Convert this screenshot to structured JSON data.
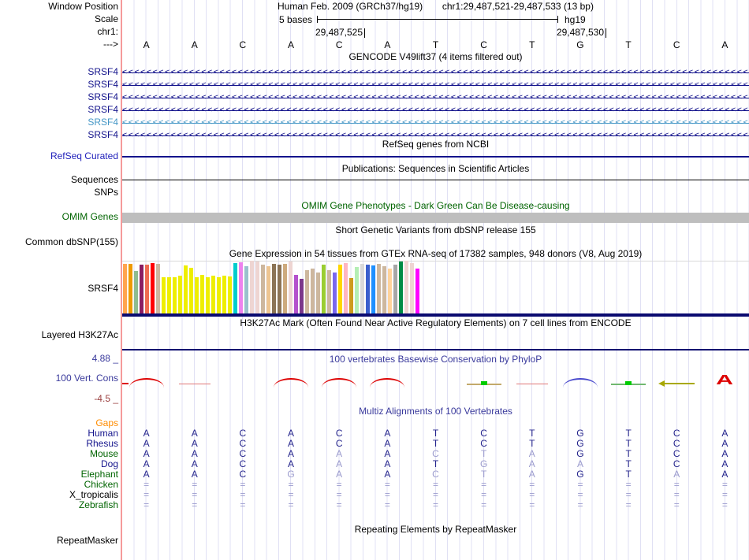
{
  "ruler": {
    "assembly": "Human Feb. 2009 (GRCh37/hg19)",
    "position": "chr1:29,487,521-29,487,533 (13 bp)",
    "scale_value": "5 bases",
    "genome": "hg19",
    "coord_left": "29,487,525",
    "coord_right": "29,487,530",
    "labels": {
      "window_position": "Window Position",
      "scale": "Scale",
      "chromosome": "chr1:",
      "strand": "--->"
    }
  },
  "sequence": {
    "bases": [
      "A",
      "A",
      "C",
      "A",
      "C",
      "A",
      "T",
      "C",
      "T",
      "G",
      "T",
      "C",
      "A"
    ]
  },
  "gencode": {
    "title": "GENCODE V49lift37 (4 items filtered out)",
    "transcripts": [
      {
        "label": "SRSF4",
        "color": "#14148C"
      },
      {
        "label": "SRSF4",
        "color": "#14148C"
      },
      {
        "label": "SRSF4",
        "color": "#14148C"
      },
      {
        "label": "SRSF4",
        "color": "#14148C"
      },
      {
        "label": "SRSF4",
        "color": "#4597C6"
      },
      {
        "label": "SRSF4",
        "color": "#14148C"
      }
    ]
  },
  "refseq": {
    "title": "RefSeq genes from NCBI",
    "label": "RefSeq Curated",
    "label_color": "#2222BB",
    "line_color": "#14148C"
  },
  "publications": {
    "title": "Publications: Sequences in Scientific Articles",
    "label": "Sequences"
  },
  "snps": {
    "label": "SNPs"
  },
  "omim": {
    "title": "OMIM Gene Phenotypes - Dark Green Can Be Disease-causing",
    "label": "OMIM Genes",
    "bar_color": "#BEBEBE"
  },
  "dbsnp": {
    "title": "Short Genetic Variants from dbSNP release 155",
    "label": "Common dbSNP(155)"
  },
  "gtex": {
    "title": "Gene Expression in 54 tissues from GTEx RNA-seq of 17382 samples, 948 donors (V8, Aug 2019)",
    "gene_label": "SRSF4",
    "baseline_color": "#0B0B70"
  },
  "chart_data": {
    "type": "bar",
    "title": "Gene Expression in 54 tissues from GTEx RNA-seq of 17382 samples, 948 donors (V8, Aug 2019)",
    "gene": "SRSF4",
    "ylim": [
      0,
      66
    ],
    "values": [
      63,
      63,
      54,
      62,
      62,
      64,
      63,
      46,
      46,
      46,
      48,
      61,
      58,
      46,
      49,
      46,
      48,
      46,
      48,
      47,
      64,
      65,
      60,
      67,
      66,
      62,
      60,
      63,
      62,
      63,
      66,
      49,
      44,
      55,
      57,
      52,
      62,
      55,
      52,
      62,
      64,
      45,
      59,
      63,
      62,
      61,
      63,
      60,
      57,
      62,
      66,
      67,
      64,
      57
    ],
    "colors": [
      "#FFA54F",
      "#EE9A00",
      "#8FBC8F",
      "#8B1C62",
      "#EE6A50",
      "#FF0000",
      "#CDB79E",
      "#EEEE00",
      "#EEEE00",
      "#EEEE00",
      "#EEEE00",
      "#EEEE00",
      "#EEEE00",
      "#EEEE00",
      "#EEEE00",
      "#EEEE00",
      "#EEEE00",
      "#EEEE00",
      "#EEEE00",
      "#EEEE00",
      "#00CDCD",
      "#EE82EE",
      "#9AC0CD",
      "#EED5D2",
      "#EED5D2",
      "#CDB79E",
      "#EEC591",
      "#8B7355",
      "#8B7355",
      "#CDAA7D",
      "#EED5D2",
      "#B452CD",
      "#7A378B",
      "#CDB79E",
      "#CDB79E",
      "#CDB79E",
      "#9ACD32",
      "#CDB79E",
      "#7A67EE",
      "#FFD700",
      "#FFB6C1",
      "#CD9B1D",
      "#B4EEB4",
      "#D9D9D9",
      "#3A5FCD",
      "#1E90FF",
      "#CDB79E",
      "#CDB79E",
      "#FFD39B",
      "#A6A6A6",
      "#008B45",
      "#EED5D2",
      "#EED5D2",
      "#FF00FF"
    ]
  },
  "h3k27ac": {
    "title": "H3K27Ac Mark (Often Found Near Active Regulatory Elements) on 7 cell lines from ENCODE",
    "label": "Layered H3K27Ac",
    "line_color": "#0B0B70"
  },
  "conservation": {
    "title": "100 vertebrates Basewise Conservation by PhyloP",
    "label": "100 Vert. Cons",
    "max_label": "4.88 _",
    "min_label": "-4.5 _",
    "max_color": "#3A3A9C",
    "min_color": "#9B4040",
    "glyphs": [
      {
        "col": 1,
        "type": "arc",
        "color": "#DD0000"
      },
      {
        "col": 2,
        "type": "line",
        "color": "#E07878"
      },
      {
        "col": 4,
        "type": "arc",
        "color": "#DD0000"
      },
      {
        "col": 5,
        "type": "arc",
        "color": "#DD0000"
      },
      {
        "col": 6,
        "type": "arc",
        "color": "#DD0000"
      },
      {
        "col": 8,
        "type": "block",
        "color": "#C3A96B",
        "accent": "#00CC00"
      },
      {
        "col": 9,
        "type": "line",
        "color": "#E07878"
      },
      {
        "col": 10,
        "type": "arc",
        "color": "#4747CC"
      },
      {
        "col": 11,
        "type": "block",
        "color": "#70B870",
        "accent": "#00CC00"
      },
      {
        "col": 12,
        "type": "arrow",
        "color": "#A8A800"
      },
      {
        "col": 13,
        "type": "letter",
        "value": "A",
        "color": "#DD0000"
      }
    ]
  },
  "multiz": {
    "title": "Multiz Alignments of 100 Vertebrates",
    "base_color": "#24248C",
    "dim_color": "#9C9CCE",
    "gaps_label_color": "#FF8C00",
    "rows": [
      {
        "name": "Gaps",
        "name_color": "#FF8C00",
        "bases": [],
        "dim": []
      },
      {
        "name": "Human",
        "name_color": "#14148C",
        "bases": [
          "A",
          "A",
          "C",
          "A",
          "C",
          "A",
          "T",
          "C",
          "T",
          "G",
          "T",
          "C",
          "A"
        ],
        "dim": [
          0,
          0,
          0,
          0,
          0,
          0,
          0,
          0,
          0,
          0,
          0,
          0,
          0
        ]
      },
      {
        "name": "Rhesus",
        "name_color": "#14148C",
        "bases": [
          "A",
          "A",
          "C",
          "A",
          "C",
          "A",
          "T",
          "C",
          "T",
          "G",
          "T",
          "C",
          "A"
        ],
        "dim": [
          0,
          0,
          0,
          0,
          0,
          0,
          0,
          0,
          0,
          0,
          0,
          0,
          0
        ]
      },
      {
        "name": "Mouse",
        "name_color": "#006400",
        "bases": [
          "A",
          "A",
          "C",
          "A",
          "A",
          "A",
          "C",
          "T",
          "A",
          "G",
          "T",
          "C",
          "A"
        ],
        "dim": [
          0,
          0,
          0,
          0,
          1,
          0,
          1,
          1,
          1,
          0,
          0,
          0,
          0
        ]
      },
      {
        "name": "Dog",
        "name_color": "#14148C",
        "bases": [
          "A",
          "A",
          "C",
          "A",
          "A",
          "A",
          "T",
          "G",
          "A",
          "A",
          "T",
          "C",
          "A"
        ],
        "dim": [
          0,
          0,
          0,
          0,
          1,
          0,
          0,
          1,
          1,
          1,
          0,
          0,
          0
        ]
      },
      {
        "name": "Elephant",
        "name_color": "#006400",
        "bases": [
          "A",
          "A",
          "C",
          "G",
          "A",
          "A",
          "C",
          "T",
          "A",
          "G",
          "T",
          "A",
          "A"
        ],
        "dim": [
          0,
          0,
          0,
          1,
          1,
          0,
          1,
          1,
          1,
          0,
          0,
          1,
          0
        ]
      },
      {
        "name": "Chicken",
        "name_color": "#006400",
        "bases": [
          "=",
          "=",
          "=",
          "=",
          "=",
          "=",
          "=",
          "=",
          "=",
          "=",
          "=",
          "=",
          "="
        ],
        "dim": [
          1,
          1,
          1,
          1,
          1,
          1,
          1,
          1,
          1,
          1,
          1,
          1,
          1
        ]
      },
      {
        "name": "X_tropicalis",
        "name_color": "#000000",
        "bases": [
          "=",
          "=",
          "=",
          "=",
          "=",
          "=",
          "=",
          "=",
          "=",
          "=",
          "=",
          "=",
          "="
        ],
        "dim": [
          1,
          1,
          1,
          1,
          1,
          1,
          1,
          1,
          1,
          1,
          1,
          1,
          1
        ]
      },
      {
        "name": "Zebrafish",
        "name_color": "#006400",
        "bases": [
          "=",
          "=",
          "=",
          "=",
          "=",
          "=",
          "=",
          "=",
          "=",
          "=",
          "=",
          "=",
          "="
        ],
        "dim": [
          1,
          1,
          1,
          1,
          1,
          1,
          1,
          1,
          1,
          1,
          1,
          1,
          1
        ]
      }
    ]
  },
  "repeatmasker": {
    "title": "Repeating Elements by RepeatMasker",
    "label": "RepeatMasker"
  }
}
